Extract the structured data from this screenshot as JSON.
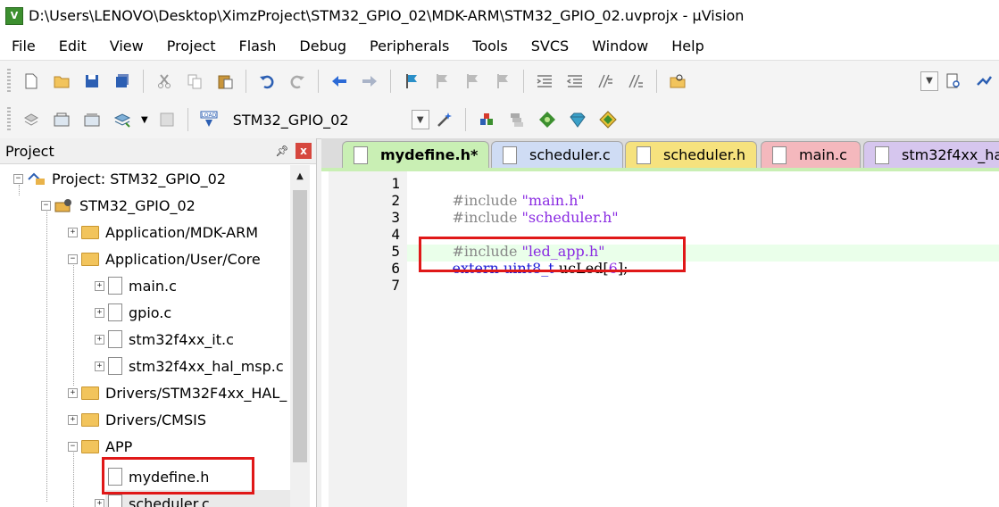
{
  "window": {
    "app_icon_text": "V",
    "title": "D:\\Users\\LENOVO\\Desktop\\XimzProject\\STM32_GPIO_02\\MDK-ARM\\STM32_GPIO_02.uvprojx - µVision"
  },
  "menu": [
    "File",
    "Edit",
    "View",
    "Project",
    "Flash",
    "Debug",
    "Peripherals",
    "Tools",
    "SVCS",
    "Window",
    "Help"
  ],
  "toolbar2": {
    "target": "STM32_GPIO_02",
    "load_label": "LOAD"
  },
  "project_panel": {
    "title": "Project",
    "pin": "ᵖ",
    "close": "x",
    "tree": [
      {
        "label": "Project: STM32_GPIO_02",
        "expander": "−",
        "kind": "project"
      },
      {
        "label": "STM32_GPIO_02",
        "expander": "−",
        "kind": "target"
      },
      {
        "label": "Application/MDK-ARM",
        "expander": "+",
        "kind": "folder"
      },
      {
        "label": "Application/User/Core",
        "expander": "−",
        "kind": "folder"
      },
      {
        "label": "main.c",
        "expander": "+",
        "kind": "file"
      },
      {
        "label": "gpio.c",
        "expander": "+",
        "kind": "file"
      },
      {
        "label": "stm32f4xx_it.c",
        "expander": "+",
        "kind": "file"
      },
      {
        "label": "stm32f4xx_hal_msp.c",
        "expander": "+",
        "kind": "file"
      },
      {
        "label": "Drivers/STM32F4xx_HAL_",
        "expander": "+",
        "kind": "folder"
      },
      {
        "label": "Drivers/CMSIS",
        "expander": "+",
        "kind": "folder"
      },
      {
        "label": "APP",
        "expander": "−",
        "kind": "folder"
      },
      {
        "label": "mydefine.h",
        "expander": "",
        "kind": "file"
      },
      {
        "label": "scheduler.c",
        "expander": "+",
        "kind": "file"
      }
    ],
    "selected": "mydefine.h"
  },
  "tabs": [
    {
      "label": "mydefine.h*",
      "color": "#c9efb4",
      "active": true
    },
    {
      "label": "scheduler.c",
      "color": "#cfdcf4"
    },
    {
      "label": "scheduler.h",
      "color": "#f6e27e"
    },
    {
      "label": "main.c",
      "color": "#f4b8bd"
    },
    {
      "label": "stm32f4xx_ha",
      "color": "#d6c6ee"
    }
  ],
  "editor": {
    "line_numbers": [
      "1",
      "2",
      "3",
      "4",
      "5",
      "6",
      "7"
    ],
    "lines": [
      {
        "directive": "#include",
        "arg": "\"main.h\""
      },
      {
        "directive": "#include",
        "arg": "\"scheduler.h\""
      },
      {
        "directive": "",
        "arg": ""
      },
      {
        "directive": "#include",
        "arg": "\"led_app.h\""
      },
      {
        "kw": "extern",
        "type": "uint8_t",
        "name": "ucLed[",
        "num": "6",
        "tail": "];"
      },
      {
        "directive": "",
        "arg": ""
      },
      {
        "directive": "",
        "arg": ""
      }
    ],
    "current_line": 5
  },
  "colors": {
    "highlight_red": "#e01818",
    "active_tab": "#c9efb4"
  }
}
